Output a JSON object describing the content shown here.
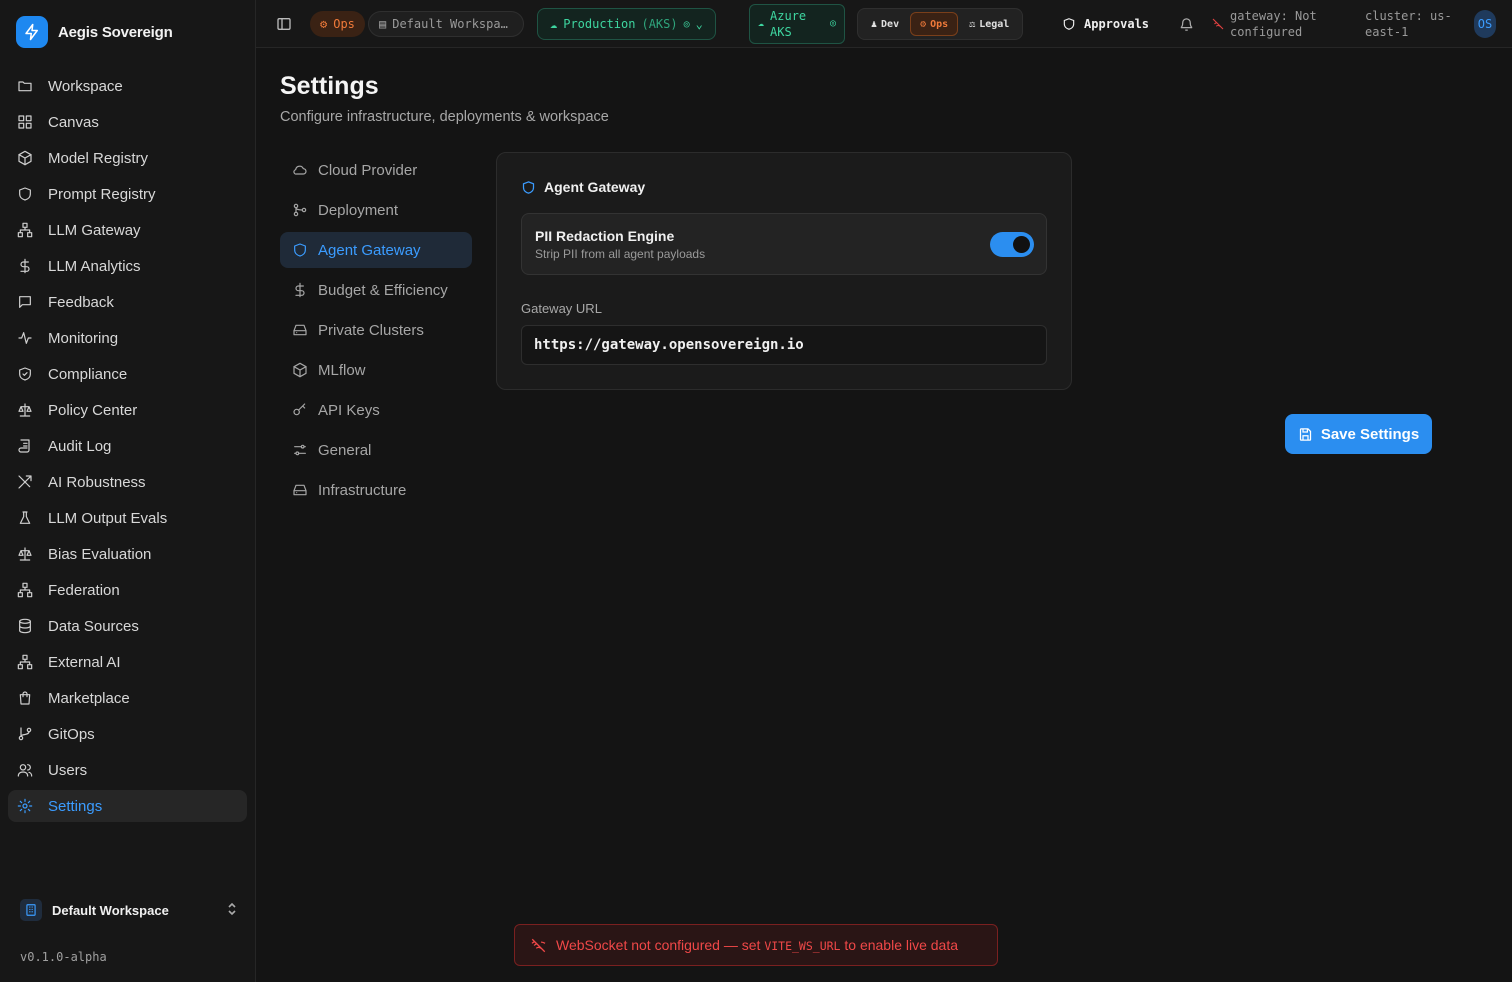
{
  "app": {
    "name": "Aegis Sovereign",
    "version": "v0.1.0-alpha"
  },
  "sidebar": {
    "items": [
      {
        "label": "Workspace",
        "icon": "folder-icon"
      },
      {
        "label": "Canvas",
        "icon": "grid-icon"
      },
      {
        "label": "Model Registry",
        "icon": "box-icon"
      },
      {
        "label": "Prompt Registry",
        "icon": "shield-icon"
      },
      {
        "label": "LLM Gateway",
        "icon": "network-icon"
      },
      {
        "label": "LLM Analytics",
        "icon": "dollar-icon"
      },
      {
        "label": "Feedback",
        "icon": "message-icon"
      },
      {
        "label": "Monitoring",
        "icon": "activity-icon"
      },
      {
        "label": "Compliance",
        "icon": "shield-check-icon"
      },
      {
        "label": "Policy Center",
        "icon": "scale-icon"
      },
      {
        "label": "Audit Log",
        "icon": "scroll-icon"
      },
      {
        "label": "AI Robustness",
        "icon": "swords-icon"
      },
      {
        "label": "LLM Output Evals",
        "icon": "flask-icon"
      },
      {
        "label": "Bias Evaluation",
        "icon": "scale-icon"
      },
      {
        "label": "Federation",
        "icon": "network-icon"
      },
      {
        "label": "Data Sources",
        "icon": "database-icon"
      },
      {
        "label": "External AI",
        "icon": "network-icon"
      },
      {
        "label": "Marketplace",
        "icon": "shopping-bag-icon"
      },
      {
        "label": "GitOps",
        "icon": "git-branch-icon"
      },
      {
        "label": "Users",
        "icon": "users-icon"
      },
      {
        "label": "Settings",
        "icon": "gear-icon",
        "active": true
      }
    ],
    "workspace_switch": "Default Workspace"
  },
  "topbar": {
    "persona_badge": "Ops",
    "workspace_select": "Default Workspa…",
    "environment": "Production",
    "environment_suffix": "(AKS)",
    "cloud_line1": "Azure",
    "cloud_line2": "AKS",
    "roles": [
      {
        "label": "Dev",
        "active": false
      },
      {
        "label": "Ops",
        "active": true
      },
      {
        "label": "Legal",
        "active": false
      }
    ],
    "approvals": "Approvals",
    "gateway_line1": "gateway: Not",
    "gateway_line2": "configured",
    "cluster_line1": "cluster: us-",
    "cluster_line2": "east-1",
    "avatar": "OS"
  },
  "page": {
    "title": "Settings",
    "subtitle": "Configure infrastructure, deployments & workspace"
  },
  "settings_nav": [
    {
      "label": "Cloud Provider",
      "icon": "cloud-icon"
    },
    {
      "label": "Deployment",
      "icon": "git-merge-icon"
    },
    {
      "label": "Agent Gateway",
      "icon": "shield-icon",
      "active": true
    },
    {
      "label": "Budget & Efficiency",
      "icon": "dollar-icon"
    },
    {
      "label": "Private Clusters",
      "icon": "hard-drive-icon"
    },
    {
      "label": "MLflow",
      "icon": "box-icon"
    },
    {
      "label": "API Keys",
      "icon": "key-icon"
    },
    {
      "label": "General",
      "icon": "sliders-icon"
    },
    {
      "label": "Infrastructure",
      "icon": "hard-drive-icon"
    }
  ],
  "gateway_card": {
    "title": "Agent Gateway",
    "pii_title": "PII Redaction Engine",
    "pii_desc": "Strip PII from all agent payloads",
    "pii_enabled": true,
    "url_label": "Gateway URL",
    "url_value": "https://gateway.opensovereign.io"
  },
  "save_button": "Save Settings",
  "toast": {
    "prefix": "WebSocket not configured — set ",
    "code": "VITE_WS_URL",
    "suffix": " to enable live data"
  },
  "colors": {
    "accent": "#2b8ef0",
    "ops": "#f07a3a",
    "env": "#3ed6a0",
    "error": "#f04848"
  }
}
